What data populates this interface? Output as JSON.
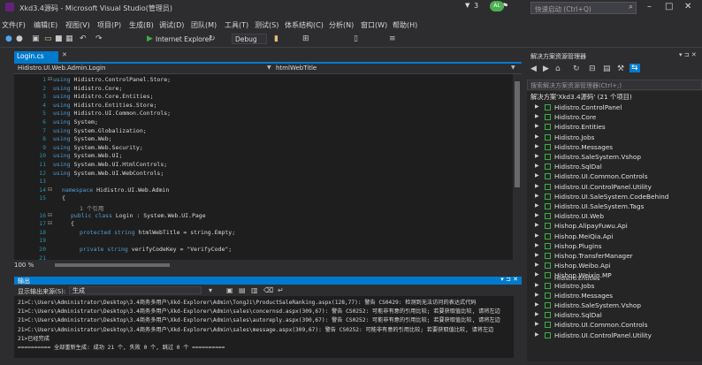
{
  "window": {
    "title": "Xkd3.4源码 - Microsoft Visual Studio(管理员)",
    "notification_count": "3",
    "quick_launch_placeholder": "快速启动 (Ctrl+Q)"
  },
  "menu": [
    "文件(F)",
    "编辑(E)",
    "视图(V)",
    "项目(P)",
    "生成(B)",
    "调试(D)",
    "团队(M)",
    "工具(T)",
    "测试(S)",
    "体系结构(C)",
    "分析(N)",
    "窗口(W)",
    "帮助(H)"
  ],
  "toolbar": {
    "browser": "Internet Explorer",
    "configuration": "Debug"
  },
  "editor": {
    "tab": "Login.cs",
    "nav_class": "Hidistro.UI.Web.Admin.Login",
    "nav_member": "htmlWebTitle",
    "zoom": "100 %",
    "lines": [
      {
        "n": "1",
        "kw": "using",
        "rest": " Hidistro.ControlPanel.Store;"
      },
      {
        "n": "2",
        "kw": "using",
        "rest": " Hidistro.Core;"
      },
      {
        "n": "3",
        "kw": "using",
        "rest": " Hidistro.Core.Entities;"
      },
      {
        "n": "4",
        "kw": "using",
        "rest": " Hidistro.Entities.Store;"
      },
      {
        "n": "5",
        "kw": "using",
        "rest": " Hidistro.UI.Common.Controls;"
      },
      {
        "n": "6",
        "kw": "using",
        "rest": " System;"
      },
      {
        "n": "7",
        "kw": "using",
        "rest": " System.Globalization;"
      },
      {
        "n": "8",
        "kw": "using",
        "rest": " System.Web;"
      },
      {
        "n": "9",
        "kw": "using",
        "rest": " System.Web.Security;"
      },
      {
        "n": "10",
        "kw": "using",
        "rest": " System.Web.UI;"
      },
      {
        "n": "11",
        "kw": "using",
        "rest": " System.Web.UI.HtmlControls;"
      },
      {
        "n": "12",
        "kw": "using",
        "rest": " System.Web.UI.WebControls;"
      },
      {
        "n": "13",
        "kw": "",
        "rest": ""
      },
      {
        "n": "14",
        "kw": "namespace",
        "rest": " Hidistro.UI.Web.Admin"
      },
      {
        "n": "15",
        "kw": "",
        "rest": "{"
      },
      {
        "n": "",
        "kw": "",
        "rest": "1 个引用",
        "ref": true
      },
      {
        "n": "16",
        "kw": "public class",
        "rest": " Login : System.Web.UI.Page"
      },
      {
        "n": "17",
        "kw": "",
        "rest": "{"
      },
      {
        "n": "18",
        "kw": "protected string",
        "rest": " htmlWebTitle = string.Empty;"
      },
      {
        "n": "19",
        "kw": "",
        "rest": ""
      },
      {
        "n": "20",
        "kw": "private string",
        "rest": " verifyCodeKey = \"VerifyCode\";"
      },
      {
        "n": "21",
        "kw": "",
        "rest": ""
      }
    ]
  },
  "output": {
    "title": "输出",
    "show_label": "显示输出来源(S):",
    "source": "生成",
    "lines": [
      "21>C:\\Users\\Administrator\\Desktop\\3.4商务多用户\\Xkd-Explorer\\Admin\\TongJi\\ProductSaleRanking.aspx(128,77): 警告 CS0429: 检测到无法访问的表达式代码",
      "21>C:\\Users\\Administrator\\Desktop\\3.4商务多用户\\Xkd-Explorer\\Admin\\sales\\concernsd.aspx(309,67): 警告 CS0252: 可能非有意的引用比较; 若要获取值比较, 请将左边",
      "21>C:\\Users\\Administrator\\Desktop\\3.4商务多用户\\Xkd-Explorer\\Admin\\sales\\autoreply.aspx(390,67): 警告 CS0252: 可能非有意的引用比较; 若要获取值比较, 请将左边",
      "21>C:\\Users\\Administrator\\Desktop\\3.4商务多用户\\Xkd-Explorer\\Admin\\sales\\message.aspx(309,67): 警告 CS0252: 可能非有意的引用比较; 若要获取值比较, 请将左边",
      "21>已经完成",
      "========== 全部重新生成: 成功 21 个, 失败 0 个, 跳过 0 个 =========="
    ]
  },
  "solution_explorer": {
    "title": "解决方案资源管理器",
    "search_placeholder": "搜索解决方案资源管理器(Ctrl+;)",
    "solution": "解决方案'Xkd3.4源码' (21 个项目)",
    "projects": [
      "Hidistro.ControlPanel",
      "Hidistro.Core",
      "Hidistro.Entities",
      "Hidistro.Jobs",
      "Hidistro.Messages",
      "Hidistro.SaleSystem.Vshop",
      "Hidistro.SqlDal",
      "Hidistro.UI.Common.Controls",
      "Hidistro.UI.ControlPanel.Utility",
      "Hidistro.UI.SaleSystem.CodeBehind",
      "Hidistro.UI.SaleSystem.Tags",
      "Hidistro.UI.Web",
      "Hishop.AlipayFuwu.Api",
      "Hishop.MeiQia.Api",
      "Hishop.Plugins",
      "Hishop.TransferManager",
      "Hishop.Weibo.Api",
      "Hishop.Weixin.MP",
      "Hidistro.Jobs",
      "Hidistro.Messages",
      "Hidistro.SaleSystem.Vshop",
      "Hidistro.SqlDal",
      "Hidistro.UI.Common.Controls",
      "Hidistro.UI.ControlPanel.Utility"
    ],
    "overlap_label": "Hidistro.Entities"
  }
}
